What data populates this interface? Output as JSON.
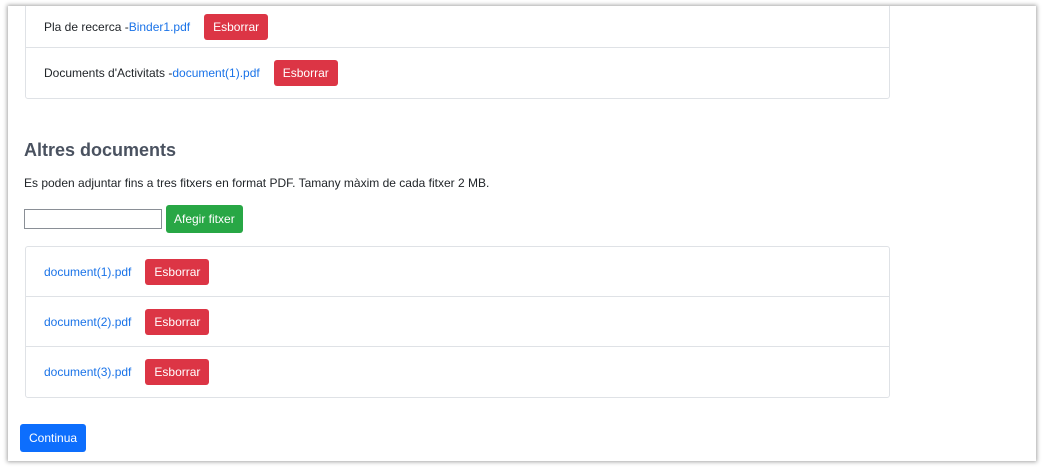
{
  "required_documents": [
    {
      "label": "Pla de recerca - ",
      "file": "Binder1.pdf",
      "delete_label": "Esborrar"
    },
    {
      "label": "Documents d'Activitats - ",
      "file": "document(1).pdf",
      "delete_label": "Esborrar"
    }
  ],
  "other_documents": {
    "title": "Altres documents",
    "description": "Es poden adjuntar fins a tres fitxers en format PDF. Tamany màxim de cada fitxer 2 MB.",
    "file_input_value": "",
    "add_label": "Afegir fitxer",
    "files": [
      {
        "file": "document(1).pdf",
        "delete_label": "Esborrar"
      },
      {
        "file": "document(2).pdf",
        "delete_label": "Esborrar"
      },
      {
        "file": "document(3).pdf",
        "delete_label": "Esborrar"
      }
    ]
  },
  "continue_label": "Continua",
  "colors": {
    "danger": "#dc3545",
    "success": "#28a745",
    "primary": "#0d6efd",
    "link": "#1a73e8"
  }
}
